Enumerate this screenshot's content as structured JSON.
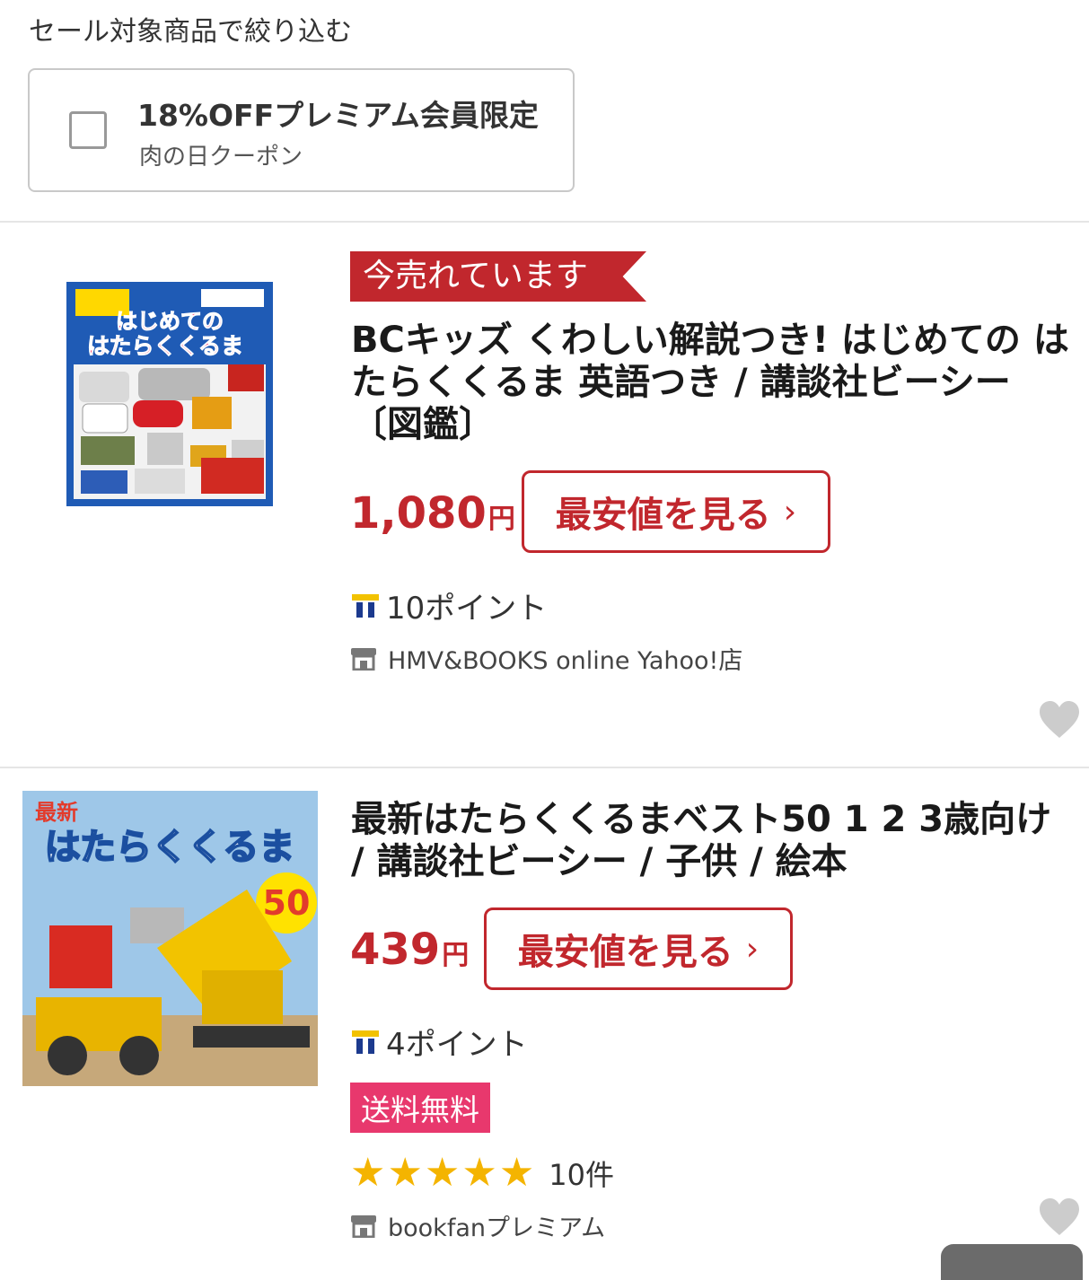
{
  "filter": {
    "title": "セール対象商品で絞り込む",
    "coupon": {
      "title": "18%OFFプレミアム会員限定",
      "subtitle": "肉の日クーポン",
      "checked": false
    }
  },
  "items": [
    {
      "badge": "今売れています",
      "title": "BCキッズ くわしい解説つき! はじめての はたらくくるま 英語つき / 講談社ビーシー 〔図鑑〕",
      "price": "1,080",
      "currency": "円",
      "button": "最安値を見る",
      "points": "10ポイント",
      "store": "HMV&BOOKS online Yahoo!店",
      "cover_text": [
        "はじめての",
        "はたらくくるま"
      ]
    },
    {
      "title": "最新はたらくくるまベスト50 1 2 3歳向け / 講談社ビーシー / 子供 / 絵本",
      "price": "439",
      "currency": "円",
      "button": "最安値を見る",
      "points": "4ポイント",
      "shipping": "送料無料",
      "rating_count": "10件",
      "rating": 5,
      "store": "bookfanプレミアム",
      "cover_text": [
        "最新",
        "はたらくくるま",
        "50"
      ]
    }
  ],
  "colors": {
    "accent": "#c1272d",
    "free_shipping": "#e8386d",
    "star": "#f4b400"
  }
}
